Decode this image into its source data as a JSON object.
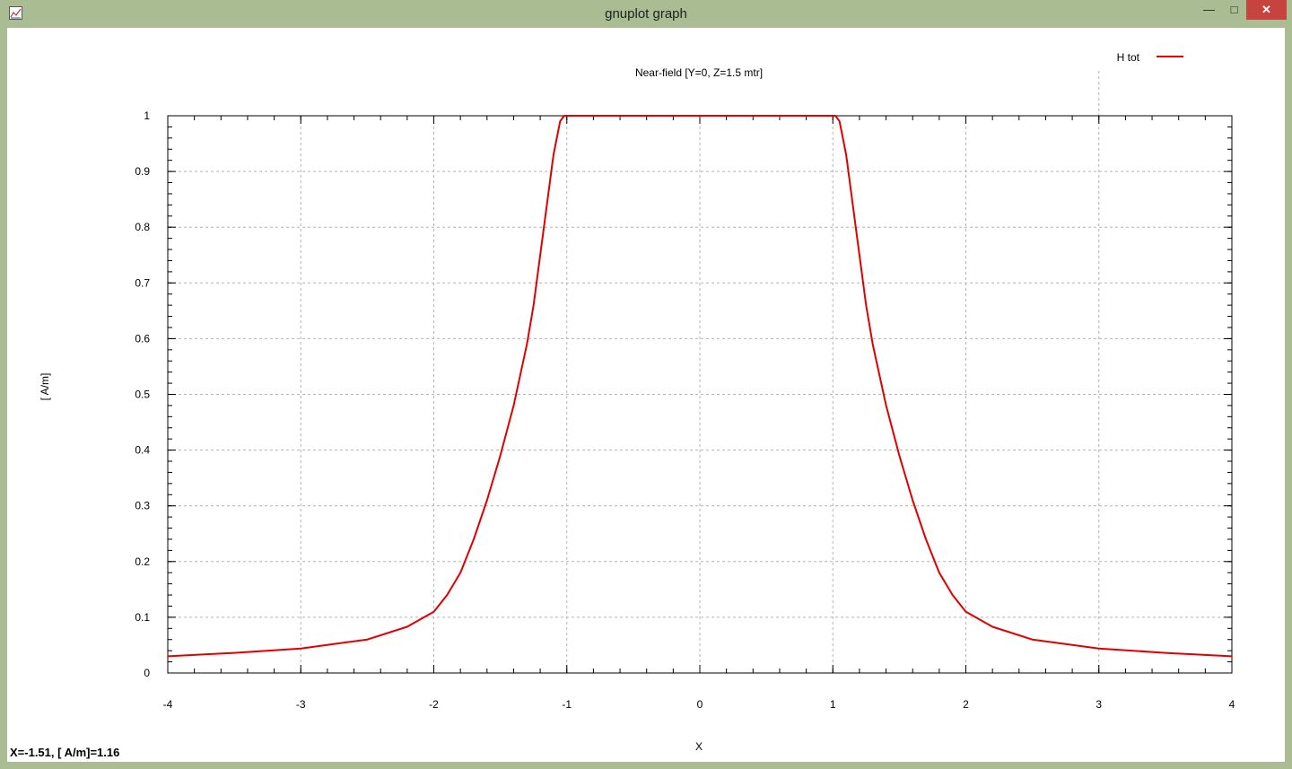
{
  "window": {
    "title": "gnuplot graph",
    "minimize_glyph": "—",
    "maximize_glyph": "□",
    "close_glyph": "✕",
    "app_icon": "gnuplot-graph-icon"
  },
  "status_bar": {
    "text": "X=-1.51, [ A/m]=1.16"
  },
  "colors": {
    "frame": "#a9bc92",
    "plot_line": "#e00000",
    "grid": "#b4b4b4",
    "close_button": "#c7433f"
  },
  "chart_data": {
    "type": "line",
    "title": "Near-field [Y=0, Z=1.5 mtr]",
    "xlabel": "X",
    "ylabel": "[ A/m]",
    "xlim": [
      -4,
      4
    ],
    "ylim": [
      0,
      1
    ],
    "xticks": [
      "-4",
      "-3",
      "-2",
      "-1",
      "0",
      "1",
      "2",
      "3",
      "4"
    ],
    "yticks": [
      "0",
      "0.1",
      "0.2",
      "0.3",
      "0.4",
      "0.5",
      "0.6",
      "0.7",
      "0.8",
      "0.9",
      "1"
    ],
    "grid": true,
    "legend": "top-right",
    "series": [
      {
        "name": "H tot",
        "color": "#e00000",
        "x": [
          -4,
          -3.5,
          -3,
          -2.5,
          -2.2,
          -2,
          -1.9,
          -1.8,
          -1.7,
          -1.6,
          -1.5,
          -1.4,
          -1.3,
          -1.25,
          -1.2,
          -1.15,
          -1.1,
          -1.05,
          -1.02,
          -1,
          0,
          1,
          1.02,
          1.05,
          1.1,
          1.15,
          1.2,
          1.25,
          1.3,
          1.4,
          1.5,
          1.6,
          1.7,
          1.8,
          1.9,
          2,
          2.2,
          2.5,
          3,
          3.5,
          4
        ],
        "y": [
          0.03,
          0.036,
          0.044,
          0.06,
          0.083,
          0.11,
          0.14,
          0.18,
          0.24,
          0.31,
          0.39,
          0.48,
          0.59,
          0.66,
          0.75,
          0.84,
          0.93,
          0.99,
          1,
          1,
          1,
          1,
          1,
          0.99,
          0.93,
          0.84,
          0.75,
          0.66,
          0.59,
          0.48,
          0.39,
          0.31,
          0.24,
          0.18,
          0.14,
          0.11,
          0.083,
          0.06,
          0.044,
          0.036,
          0.03
        ]
      }
    ]
  }
}
